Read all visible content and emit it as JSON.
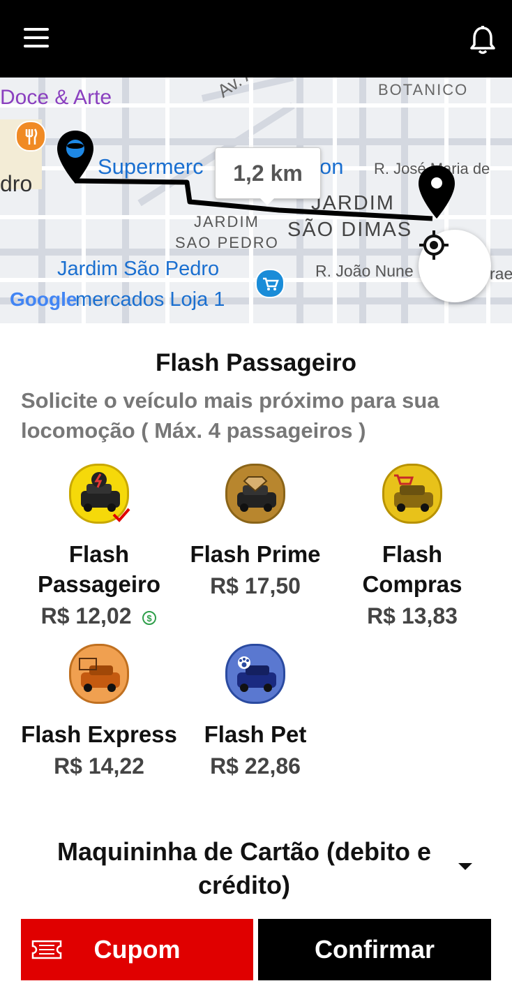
{
  "header": {
    "menu_icon": "hamburger-menu-icon",
    "bell_icon": "bell-icon"
  },
  "map": {
    "labels": {
      "doce_arte": "Doce & Arte",
      "av_angelica": "Av. Ange",
      "botanico": "BOTANICO",
      "supermerc": "Supermerc",
      "on": "on",
      "dro": "dro",
      "rua_jose_maria": "R. José Maria de",
      "jardim_sao_dimas_1": "JARDIM",
      "jardim_sao_dimas_2": "SÃO DIMAS",
      "jardim_sao_pedro_1": "JARDIM",
      "jardim_sao_pedro_2": "SAO PEDRO",
      "jardim_sao_pedro_poi": "Jardim São Pedro",
      "rua_joao_nunes": "R. João Nune",
      "rae": "rae",
      "supermercados_loja": "mercados Loja 1",
      "google": "Google"
    },
    "distance": "1,2 km",
    "locate_icon": "my-location-icon",
    "route_color": "#000000"
  },
  "service": {
    "title": "Flash Passageiro",
    "description": "Solicite o veículo mais próximo para sua locomoção ( Máx. 4 passageiros )"
  },
  "vehicles": [
    {
      "name": "Flash Passageiro",
      "price": "R$ 12,02",
      "selected": true,
      "color": "#f5d90a",
      "icon": "lightning-car-icon"
    },
    {
      "name": "Flash Prime",
      "price": "R$ 17,50",
      "selected": false,
      "color": "#b8862e",
      "icon": "diamond-car-icon"
    },
    {
      "name": "Flash Compras",
      "price": "R$ 13,83",
      "selected": false,
      "color": "#e8c21a",
      "icon": "shopping-cart-car-icon"
    },
    {
      "name": "Flash Express",
      "price": "R$ 14,22",
      "selected": false,
      "color": "#f0a050",
      "icon": "package-car-icon"
    },
    {
      "name": "Flash Pet",
      "price": "R$ 22,86",
      "selected": false,
      "color": "#5a78d0",
      "icon": "paw-car-icon"
    }
  ],
  "payment": {
    "label": "Maquininha de Cartão (debito e crédito)"
  },
  "actions": {
    "cupom": "Cupom",
    "confirm": "Confirmar"
  },
  "colors": {
    "accent_red": "#e00000",
    "black": "#000000",
    "route": "#000000"
  }
}
